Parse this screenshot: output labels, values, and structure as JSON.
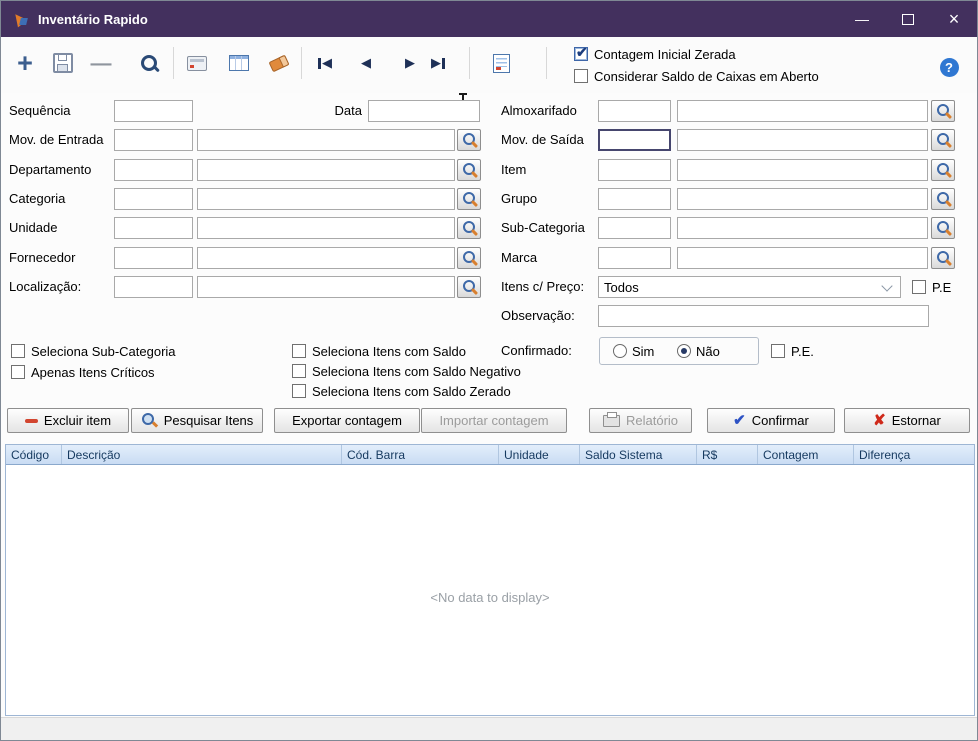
{
  "window": {
    "title": "Inventário Rapido"
  },
  "icons": {
    "add": "+",
    "remove": "—",
    "prev": "◀",
    "next": "▶",
    "check": "✔",
    "cross": "✘",
    "help": "?",
    "minimize": "—",
    "close": "×"
  },
  "toolbar": {
    "contagem_inicial_zerada": "Contagem Inicial Zerada",
    "considerar_saldo": "Considerar Saldo de Caixas em Aberto"
  },
  "fields": {
    "sequencia": "Sequência",
    "data": "Data",
    "almoxarifado": "Almoxarifado",
    "mov_entrada": "Mov. de Entrada",
    "mov_saida": "Mov. de Saída",
    "departamento": "Departamento",
    "item": "Item",
    "categoria": "Categoria",
    "grupo": "Grupo",
    "unidade": "Unidade",
    "sub_categoria": "Sub-Categoria",
    "fornecedor": "Fornecedor",
    "marca": "Marca",
    "localizacao": "Localização:",
    "itens_preco": "Itens c/ Preço:",
    "itens_preco_value": "Todos",
    "pe_short": "P.E",
    "observacao": "Observação:"
  },
  "options": {
    "seleciona_sub_categoria": "Seleciona Sub-Categoria",
    "apenas_itens_criticos": "Apenas Itens Críticos",
    "itens_com_saldo": "Seleciona Itens com Saldo",
    "itens_saldo_negativo": "Seleciona Itens com Saldo Negativo",
    "itens_saldo_zerado": "Seleciona Itens com Saldo Zerado",
    "confirmado": "Confirmado:",
    "sim": "Sim",
    "nao": "Não",
    "pe": "P.E."
  },
  "buttons": {
    "excluir": "Excluir item",
    "pesquisar": "Pesquisar Itens",
    "exportar": "Exportar contagem",
    "importar": "Importar contagem",
    "relatorio": "Relatório",
    "confirmar": "Confirmar",
    "estornar": "Estornar"
  },
  "grid": {
    "headers": [
      "Código",
      "Descrição",
      "Cód. Barra",
      "Unidade",
      "Saldo Sistema",
      "R$",
      "Contagem",
      "Diferença"
    ],
    "empty": "<No data to display>"
  }
}
